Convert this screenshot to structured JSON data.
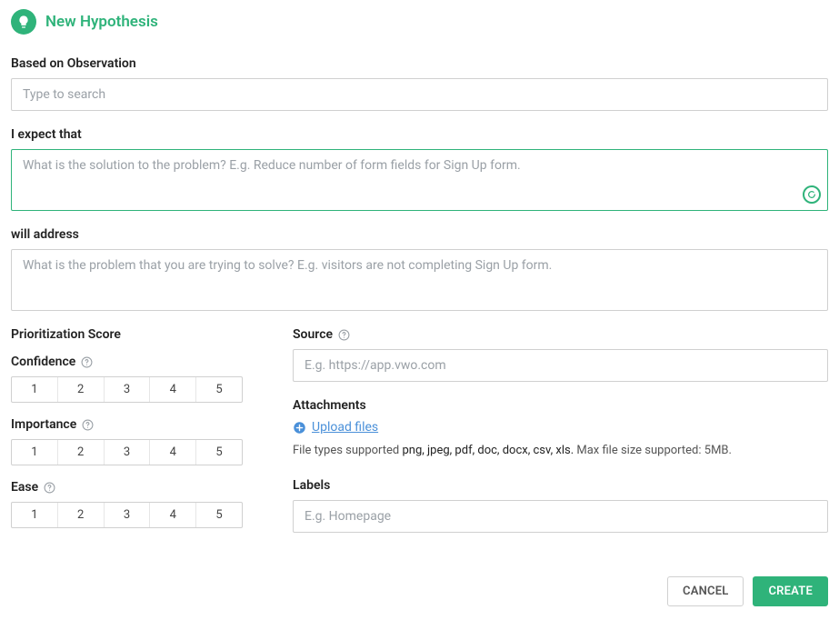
{
  "header": {
    "title": "New Hypothesis"
  },
  "observation": {
    "label": "Based on Observation",
    "placeholder": "Type to search"
  },
  "expect": {
    "label": "I expect that",
    "placeholder": "What is the solution to the problem? E.g. Reduce number of form fields for Sign Up form."
  },
  "address": {
    "label": "will address",
    "placeholder": "What is the problem that you are trying to solve? E.g. visitors are not completing Sign Up form."
  },
  "prioritization": {
    "title": "Prioritization Score",
    "confidence": {
      "label": "Confidence",
      "options": [
        "1",
        "2",
        "3",
        "4",
        "5"
      ]
    },
    "importance": {
      "label": "Importance",
      "options": [
        "1",
        "2",
        "3",
        "4",
        "5"
      ]
    },
    "ease": {
      "label": "Ease",
      "options": [
        "1",
        "2",
        "3",
        "4",
        "5"
      ]
    }
  },
  "source": {
    "label": "Source",
    "placeholder": "E.g. https://app.vwo.com"
  },
  "attachments": {
    "label": "Attachments",
    "upload_label": "Upload files",
    "note_prefix": "File types supported ",
    "note_types": "png, jpeg, pdf, doc, docx, csv, xls.",
    "note_suffix": " Max file size supported: 5MB."
  },
  "labels": {
    "label": "Labels",
    "placeholder": "E.g. Homepage"
  },
  "footer": {
    "cancel": "CANCEL",
    "create": "CREATE"
  }
}
